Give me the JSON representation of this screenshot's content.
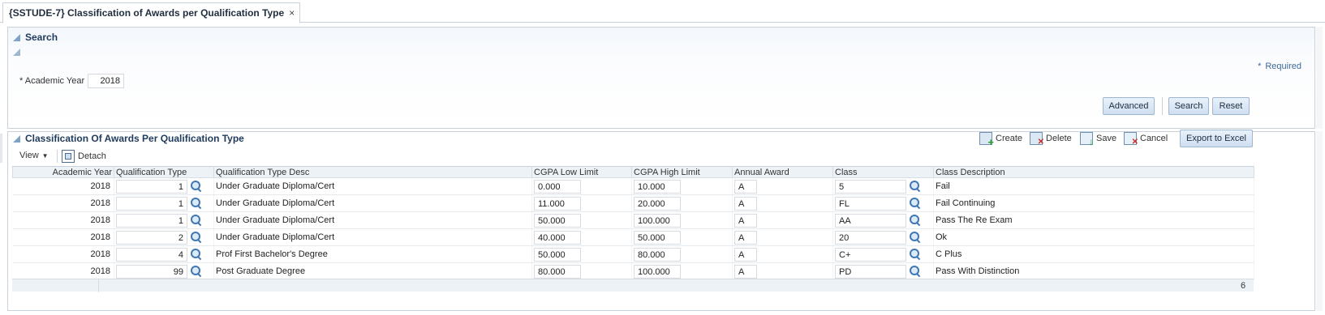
{
  "tab": {
    "title": "{SSTUDE-7} Classification of Awards per Qualification Type",
    "close": "×"
  },
  "search": {
    "title": "Search",
    "required_note": "Required",
    "required_star": "*",
    "academic_year_label": "* Academic Year",
    "academic_year_value": "2018",
    "buttons": {
      "advanced": "Advanced",
      "search": "Search",
      "reset": "Reset"
    }
  },
  "results": {
    "title": "Classification Of Awards Per Qualification Type",
    "toolbar": {
      "create": "Create",
      "delete": "Delete",
      "save": "Save",
      "cancel": "Cancel",
      "export": "Export to Excel"
    },
    "view_menu": "View",
    "detach": "Detach",
    "columns": [
      "Academic Year",
      "Qualification Type",
      "Qualification Type Desc",
      "CGPA Low Limit",
      "CGPA High Limit",
      "Annual Award",
      "Class",
      "Class Description"
    ],
    "rows": [
      [
        "2018",
        "1",
        "Under Graduate Diploma/Cert",
        "0.000",
        "10.000",
        "A",
        "5",
        "Fail"
      ],
      [
        "2018",
        "1",
        "Under Graduate Diploma/Cert",
        "11.000",
        "20.000",
        "A",
        "FL",
        "Fail Continuing"
      ],
      [
        "2018",
        "1",
        "Under Graduate Diploma/Cert",
        "50.000",
        "100.000",
        "A",
        "AA",
        "Pass The Re Exam"
      ],
      [
        "2018",
        "2",
        "Under Graduate Diploma/Cert",
        "40.000",
        "50.000",
        "A",
        "20",
        "Ok"
      ],
      [
        "2018",
        "4",
        "Prof First Bachelor's Degree",
        "50.000",
        "80.000",
        "A",
        "C+",
        "C Plus"
      ],
      [
        "2018",
        "99",
        "Post Graduate Degree",
        "80.000",
        "100.000",
        "A",
        "PD",
        "Pass With Distinction"
      ]
    ],
    "row_count": "6"
  }
}
